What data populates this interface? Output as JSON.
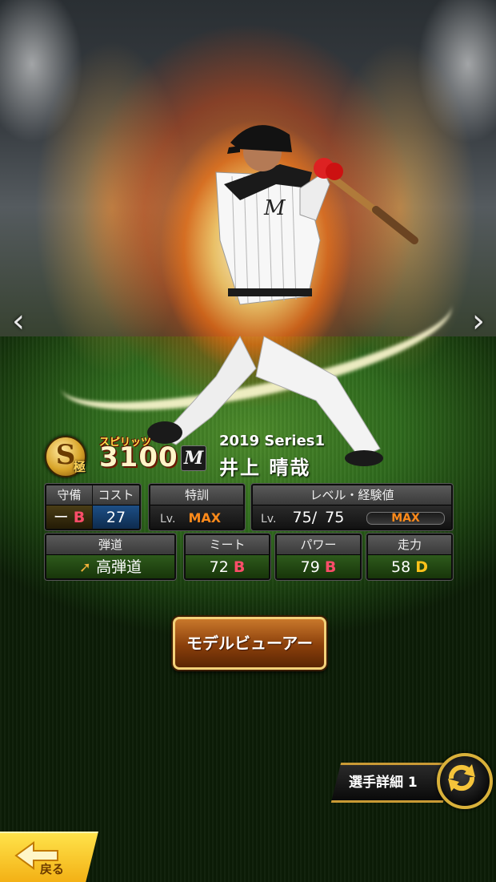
{
  "nav": {
    "prev_glyph": "‹",
    "next_glyph": "›"
  },
  "card": {
    "rank_letter": "S",
    "rank_sub": "極",
    "spirits_label": "スピリッツ",
    "spirits_value": "3100",
    "team_logo_text": "M",
    "series": "2019 Series1",
    "player_name": "井上 晴哉"
  },
  "stats": {
    "defense": {
      "label": "守備",
      "value": "ー",
      "grade": "B"
    },
    "cost": {
      "label": "コスト",
      "value": "27"
    },
    "training": {
      "label": "特訓",
      "lv_prefix": "Lv.",
      "value": "MAX"
    },
    "level": {
      "label": "レベル・経験値",
      "lv_prefix": "Lv.",
      "current": "75",
      "separator": "/",
      "max": "75",
      "exp_label": "MAX"
    },
    "trajectory": {
      "label": "弾道",
      "value": "高弾道"
    },
    "contact": {
      "label": "ミート",
      "value": "72",
      "grade": "B"
    },
    "power": {
      "label": "パワー",
      "value": "79",
      "grade": "B"
    },
    "speed": {
      "label": "走力",
      "value": "58",
      "grade": "D"
    }
  },
  "buttons": {
    "model_viewer": "モデルビューアー",
    "player_detail": "選手詳細 1",
    "back": "戻る"
  },
  "colors": {
    "grade_b": "#ff4d6a",
    "grade_d": "#ffc21a",
    "max": "#ff8a1a",
    "gold": "#d9b13a"
  }
}
